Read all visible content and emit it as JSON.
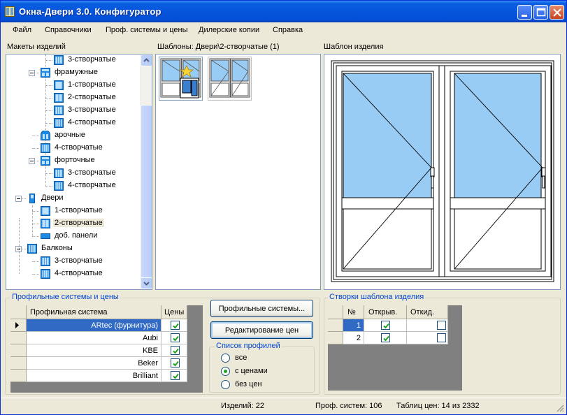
{
  "window": {
    "title": "Окна-Двери 3.0.  Конфигуратор"
  },
  "menu": [
    "Файл",
    "Справочники",
    "Проф. системы и цены",
    "Дилерские копии",
    "Справка"
  ],
  "panels": {
    "tree_title": "Макеты изделий",
    "templates_title": "Шаблоны: Двери\\2-створчатые (1)",
    "preview_title": "Шаблон изделия"
  },
  "tree": [
    {
      "label": "3-створчатые",
      "level": 2,
      "icon": "window-3-icon"
    },
    {
      "label": "фрамужные",
      "level": 1,
      "icon": "transom-window-icon",
      "expanded": true
    },
    {
      "label": "1-створчатые",
      "level": 2,
      "icon": "window-1-icon"
    },
    {
      "label": "2-створчатые",
      "level": 2,
      "icon": "window-2-icon"
    },
    {
      "label": "3-створчатые",
      "level": 2,
      "icon": "window-3-icon"
    },
    {
      "label": "4-створчатые",
      "level": 2,
      "icon": "window-4-icon"
    },
    {
      "label": "арочные",
      "level": 1,
      "icon": "arched-window-icon"
    },
    {
      "label": "4-створчатые",
      "level": 1,
      "icon": "window-4-icon"
    },
    {
      "label": "форточные",
      "level": 1,
      "icon": "vent-window-icon",
      "expanded": true
    },
    {
      "label": "3-створчатые",
      "level": 2,
      "icon": "window-3-icon"
    },
    {
      "label": "4-створчатые",
      "level": 2,
      "icon": "window-4-icon"
    },
    {
      "label": "Двери",
      "level": 0,
      "icon": "door-icon",
      "expanded": true
    },
    {
      "label": "1-створчатые",
      "level": 1,
      "icon": "door-1-icon"
    },
    {
      "label": "2-створчатые",
      "level": 1,
      "icon": "door-2-icon",
      "selected": true
    },
    {
      "label": "доб. панели",
      "level": 1,
      "icon": "panel-icon"
    },
    {
      "label": "Балконы",
      "level": 0,
      "icon": "balcony-icon",
      "expanded": true
    },
    {
      "label": "3-створчатые",
      "level": 1,
      "icon": "window-3-icon"
    },
    {
      "label": "4-створчатые",
      "level": 1,
      "icon": "window-4-icon"
    }
  ],
  "profiles": {
    "group_title": "Профильные системы и цены",
    "col_system": "Профильная система",
    "col_prices": "Цены",
    "rows": [
      {
        "name": "ARtec (фурнитура)",
        "prices": true,
        "selected": true
      },
      {
        "name": "Aubi",
        "prices": true
      },
      {
        "name": "KBE",
        "prices": true
      },
      {
        "name": "Beker",
        "prices": true
      },
      {
        "name": "Brilliant",
        "prices": true
      }
    ]
  },
  "buttons": {
    "profile_systems": "Профильные системы...",
    "edit_prices": "Редактирование цен"
  },
  "profile_list": {
    "title": "Список профилей",
    "options": [
      "все",
      "с ценами",
      "без цен"
    ],
    "selected_index": 1
  },
  "sashes": {
    "group_title": "Створки шаблона изделия",
    "col_num": "№",
    "col_open": "Открыв.",
    "col_tilt": "Откид.",
    "rows": [
      {
        "num": "1",
        "open": true,
        "tilt": false
      },
      {
        "num": "2",
        "open": true,
        "tilt": false
      }
    ]
  },
  "status": {
    "items": "Изделий: 22",
    "systems": "Проф. систем: 106",
    "tables": "Таблиц цен: 14 из 2332"
  },
  "colors": {
    "glass": "#99ccf5",
    "accent": "#0046d5",
    "selection": "#316ac5"
  }
}
